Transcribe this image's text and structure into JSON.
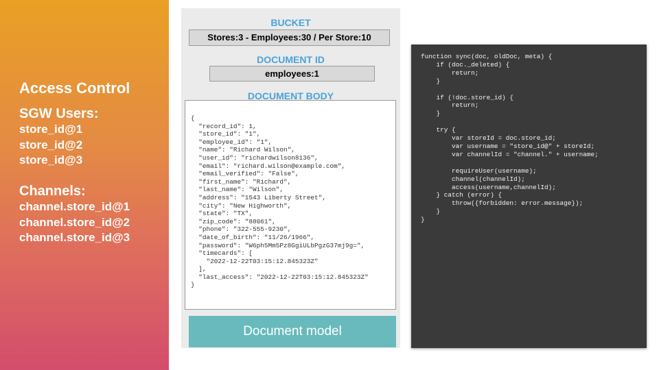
{
  "sidebar": {
    "title": "Access Control",
    "sgw_heading": "SGW Users:",
    "users": [
      "store_id@1",
      "store_id@2",
      "store_id@3"
    ],
    "channels_heading": "Channels:",
    "channels": [
      "channel.store_id@1",
      "channel.store_id@2",
      "channel.store_id@3"
    ]
  },
  "document": {
    "bucket_label": "BUCKET",
    "bucket_value": "Stores:3 - Employees:30 / Per Store:10",
    "docid_label": "DOCUMENT ID",
    "docid_value": "employees:1",
    "body_label": "DOCUMENT BODY",
    "body_text": "{\n  \"record_id\": 1,\n  \"store_id\": \"1\",\n  \"employee_id\": \"1\",\n  \"name\": \"Richard Wilson\",\n  \"user_id\": \"richardwilson8136\",\n  \"email\": \"richard.wilson@example.com\",\n  \"email_verified\": \"False\",\n  \"first_name\": \"Richard\",\n  \"last_name\": \"Wilson\",\n  \"address\": \"1543 Liberty Street\",\n  \"city\": \"New Highworth\",\n  \"state\": \"TX\",\n  \"zip_code\": \"88061\",\n  \"phone\": \"322-555-9230\",\n  \"date_of_birth\": \"11/26/1966\",\n  \"password\": \"W6ph5Mm5Pz8GgiULbPgzG37mj9g=\",\n  \"timecards\": [\n    \"2022-12-22T03:15:12.845323Z\"\n  ],\n  \"last_access\": \"2022-12-22T03:15:12.845323Z\"\n}",
    "model_label": "Document model"
  },
  "sync_function": {
    "code": "function sync(doc, oldDoc, meta) {\n    if (doc._deleted) {\n        return;\n    }\n\n    if (!doc.store_id) {\n        return;\n    }\n\n    try {\n        var storeId = doc.store_id;\n        var username = \"store_id@\" + storeId;\n        var channelId = \"channel.\" + username;\n\n        requireUser(username);\n        channel(channelId);\n        access(username,channelId);\n    } catch (error) {\n        throw({forbidden: error.message});\n    }\n}"
  }
}
